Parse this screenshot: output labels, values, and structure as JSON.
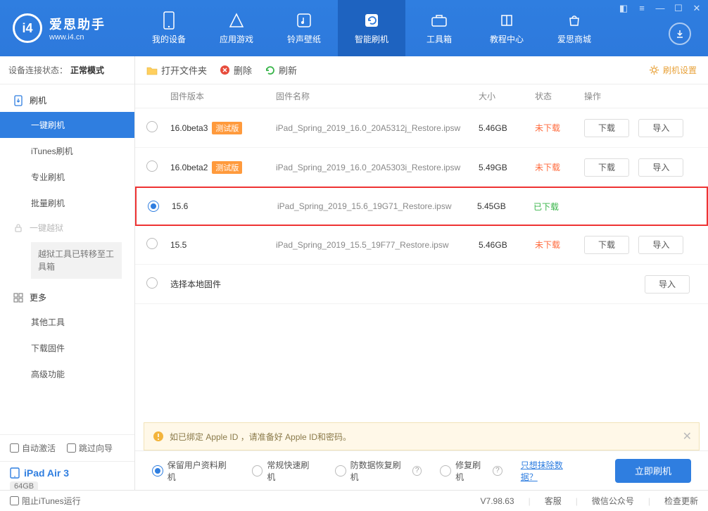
{
  "app": {
    "title": "爱思助手",
    "url": "www.i4.cn"
  },
  "nav": [
    {
      "label": "我的设备"
    },
    {
      "label": "应用游戏"
    },
    {
      "label": "铃声壁纸"
    },
    {
      "label": "智能刷机"
    },
    {
      "label": "工具箱"
    },
    {
      "label": "教程中心"
    },
    {
      "label": "爱思商城"
    }
  ],
  "conn": {
    "prefix": "设备连接状态：",
    "mode": "正常模式"
  },
  "side": {
    "group_flash": "刷机",
    "items_flash": [
      "一键刷机",
      "iTunes刷机",
      "专业刷机",
      "批量刷机"
    ],
    "group_jb": "一键越狱",
    "jb_note": "越狱工具已转移至工具箱",
    "group_more": "更多",
    "items_more": [
      "其他工具",
      "下载固件",
      "高级功能"
    ]
  },
  "chk": {
    "auto_activate": "自动激活",
    "skip_guide": "跳过向导"
  },
  "device": {
    "name": "iPad Air 3",
    "cap": "64GB",
    "type": "iPad"
  },
  "toolbar": {
    "open": "打开文件夹",
    "delete": "删除",
    "refresh": "刷新",
    "settings": "刷机设置"
  },
  "table": {
    "head": {
      "ver": "固件版本",
      "name": "固件名称",
      "size": "大小",
      "status": "状态",
      "ops": "操作"
    },
    "beta_tag": "测试版",
    "btn_download": "下载",
    "btn_import": "导入",
    "status_no": "未下载",
    "status_yes": "已下载",
    "local": "选择本地固件",
    "rows": [
      {
        "ver": "16.0beta3",
        "beta": true,
        "name": "iPad_Spring_2019_16.0_20A5312j_Restore.ipsw",
        "size": "5.46GB",
        "downloaded": false
      },
      {
        "ver": "16.0beta2",
        "beta": true,
        "name": "iPad_Spring_2019_16.0_20A5303i_Restore.ipsw",
        "size": "5.49GB",
        "downloaded": false
      },
      {
        "ver": "15.6",
        "beta": false,
        "name": "iPad_Spring_2019_15.6_19G71_Restore.ipsw",
        "size": "5.45GB",
        "downloaded": true,
        "selected": true
      },
      {
        "ver": "15.5",
        "beta": false,
        "name": "iPad_Spring_2019_15.5_19F77_Restore.ipsw",
        "size": "5.46GB",
        "downloaded": false
      }
    ]
  },
  "notice": "如已绑定 Apple ID ，请准备好 Apple ID和密码。",
  "flash": {
    "opts": [
      "保留用户资料刷机",
      "常规快速刷机",
      "防数据恢复刷机",
      "修复刷机"
    ],
    "erase_link": "只想抹除数据？",
    "btn": "立即刷机"
  },
  "footer": {
    "block_itunes": "阻止iTunes运行",
    "version": "V7.98.63",
    "svc": "客服",
    "wechat": "微信公众号",
    "update": "检查更新"
  }
}
